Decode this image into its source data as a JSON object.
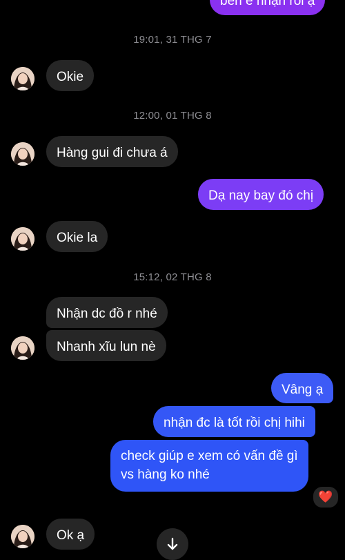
{
  "messages": {
    "top_partial": "bên e nhận rồi ạ",
    "ts1": "19:01, 31 THG 7",
    "m1": "Okie",
    "ts2": "12:00, 01 THG 8",
    "m2": "Hàng gui đi chưa á",
    "m3": "Dạ nay bay đó chị",
    "m4": "Okie la",
    "ts3": "15:12, 02 THG 8",
    "m5": "Nhận dc đồ r nhé",
    "m6": "Nhanh xĩu lun nè",
    "m7": "Vâng ạ",
    "m8": "nhận đc là tốt rồi chị hihi",
    "m9_line1": "check giúp e xem có vấn đề gì",
    "m9_line2": "vs hàng ko nhé",
    "m10": "Ok ạ"
  },
  "reaction": {
    "emoji": "❤️",
    "icon": "heart-icon"
  },
  "controls": {
    "scroll_icon": "arrow-down-icon"
  },
  "colors": {
    "incoming": "#262626",
    "outgoing_purple": "#7a3cf5",
    "outgoing_blue": "#3a55f5",
    "timestamp": "#8e8e93"
  }
}
